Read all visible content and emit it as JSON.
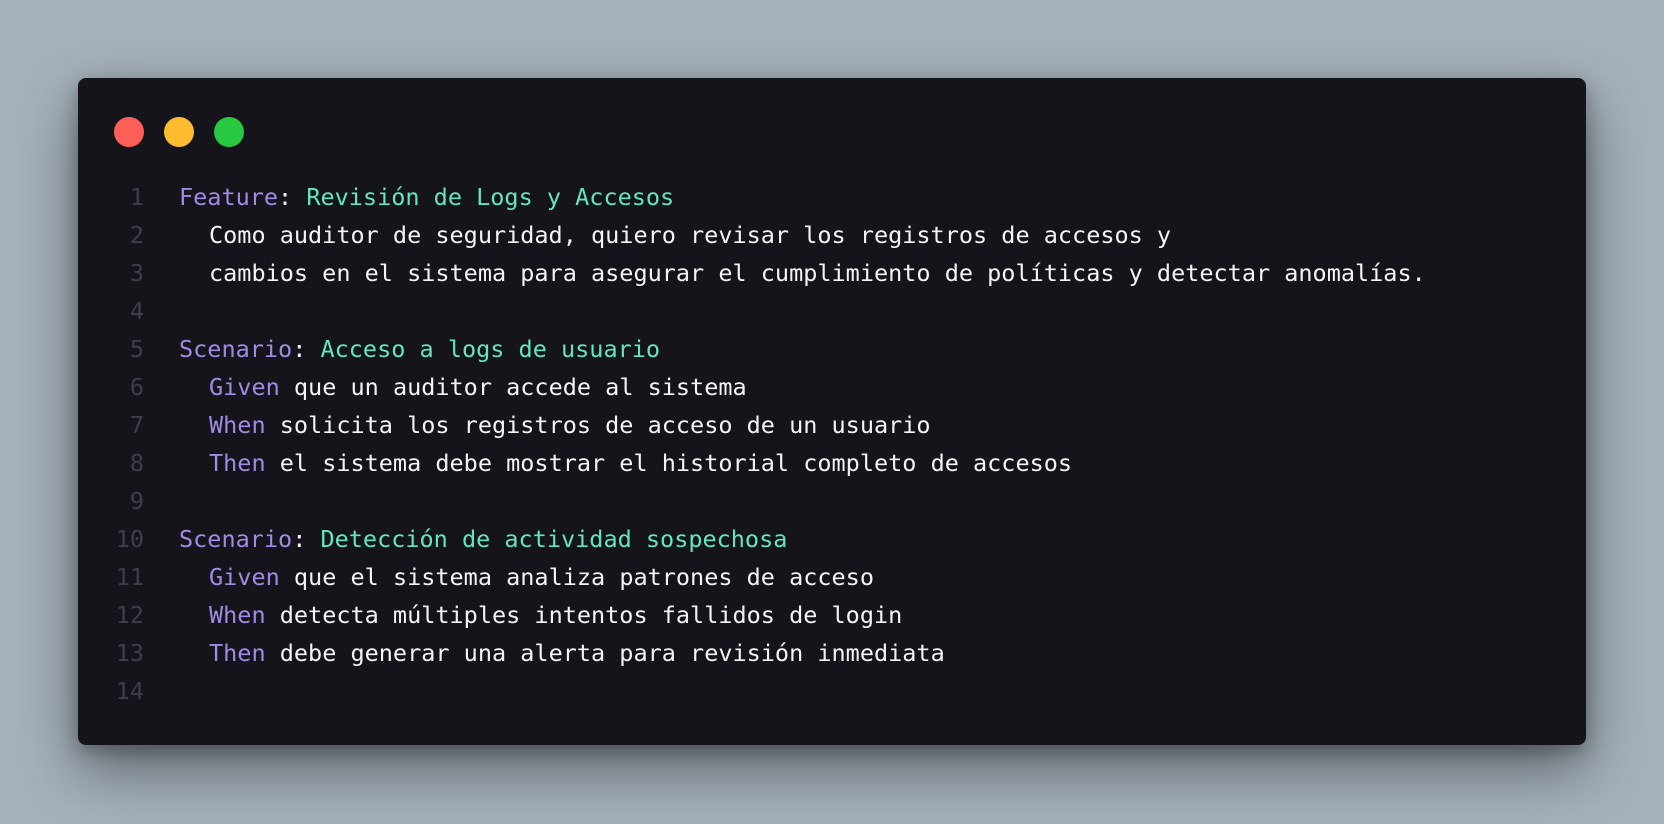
{
  "window": {
    "controls": {
      "close_color": "#ff5f57",
      "minimize_color": "#febc2e",
      "maximize_color": "#28c840"
    }
  },
  "colors": {
    "background": "#a6b1bb",
    "panel": "#15141a",
    "keyword": "#a18ae6",
    "title": "#63e6c0",
    "text": "#f4f4f6",
    "line_number": "#3f3e4d"
  },
  "code": {
    "lines": [
      {
        "num": "1",
        "kw": "Feature",
        "sep": ": ",
        "title": "Revisión de Logs y Accesos",
        "text": ""
      },
      {
        "num": "2",
        "kw": "",
        "sep": "",
        "title": "",
        "text": "Como auditor de seguridad, quiero revisar los registros de accesos y"
      },
      {
        "num": "3",
        "kw": "",
        "sep": "",
        "title": "",
        "text": "cambios en el sistema para asegurar el cumplimiento de políticas y detectar anomalías."
      },
      {
        "num": "4",
        "kw": "",
        "sep": "",
        "title": "",
        "text": ""
      },
      {
        "num": "5",
        "kw": "Scenario",
        "sep": ": ",
        "title": "Acceso a logs de usuario",
        "text": ""
      },
      {
        "num": "6",
        "kw": "Given",
        "sep": " ",
        "title": "",
        "text": "que un auditor accede al sistema"
      },
      {
        "num": "7",
        "kw": "When",
        "sep": " ",
        "title": "",
        "text": "solicita los registros de acceso de un usuario"
      },
      {
        "num": "8",
        "kw": "Then",
        "sep": " ",
        "title": "",
        "text": "el sistema debe mostrar el historial completo de accesos"
      },
      {
        "num": "9",
        "kw": "",
        "sep": "",
        "title": "",
        "text": ""
      },
      {
        "num": "10",
        "kw": "Scenario",
        "sep": ": ",
        "title": "Detección de actividad sospechosa",
        "text": ""
      },
      {
        "num": "11",
        "kw": "Given",
        "sep": " ",
        "title": "",
        "text": "que el sistema analiza patrones de acceso"
      },
      {
        "num": "12",
        "kw": "When",
        "sep": " ",
        "title": "",
        "text": "detecta múltiples intentos fallidos de login"
      },
      {
        "num": "13",
        "kw": "Then",
        "sep": " ",
        "title": "",
        "text": "debe generar una alerta para revisión inmediata"
      },
      {
        "num": "14",
        "kw": "",
        "sep": "",
        "title": "",
        "text": ""
      }
    ]
  }
}
